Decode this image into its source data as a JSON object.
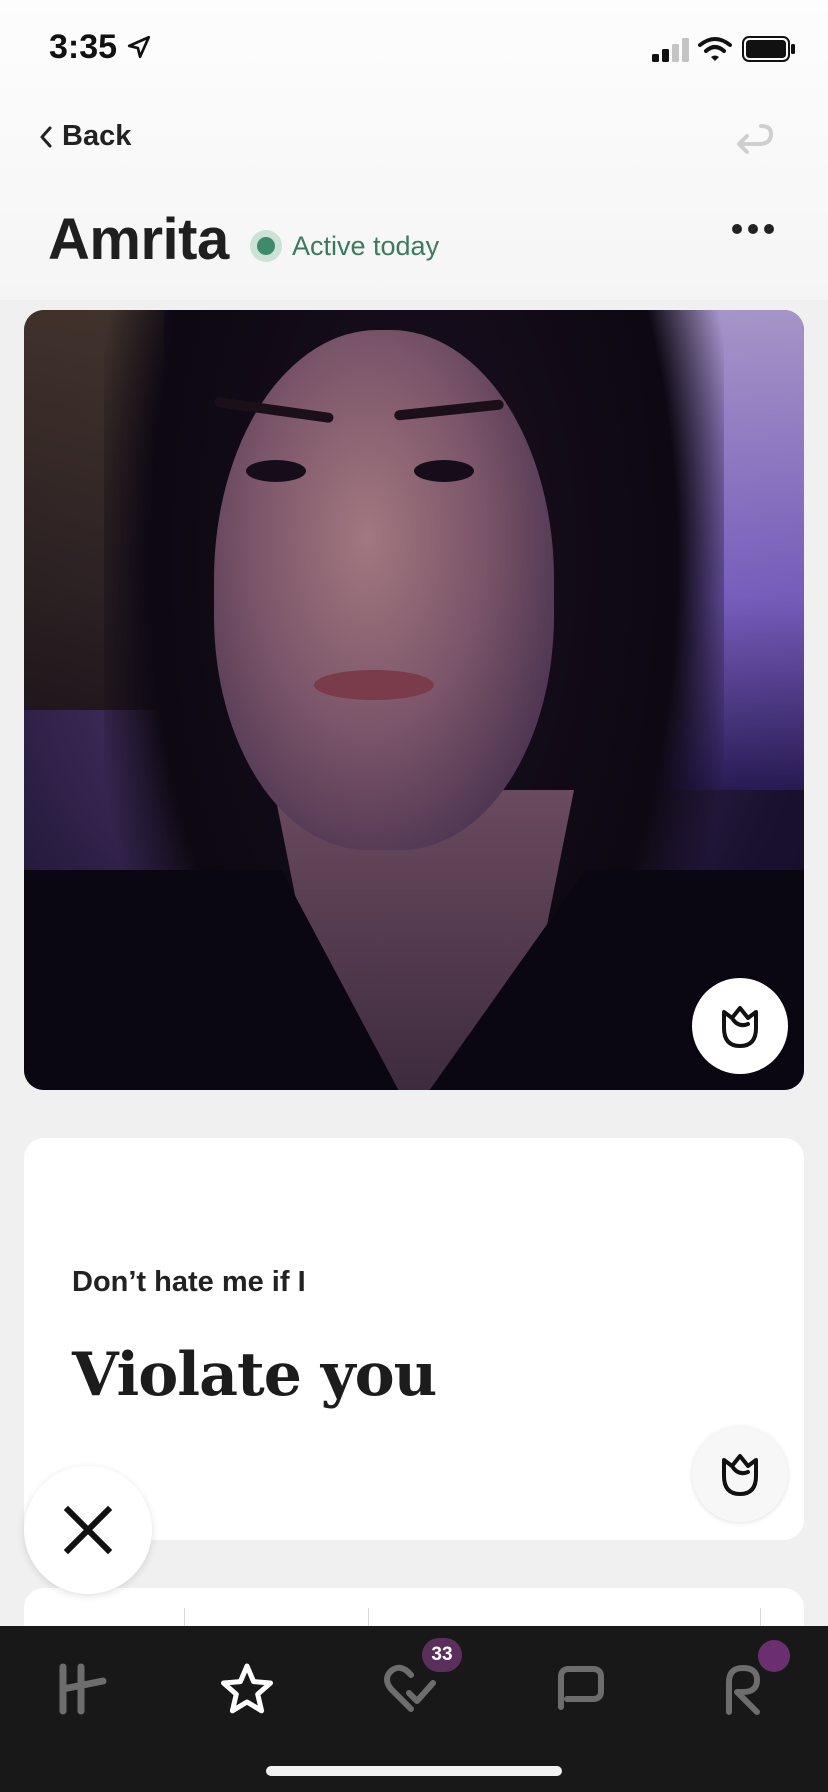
{
  "status_bar": {
    "time": "3:35"
  },
  "nav": {
    "back_label": "Back"
  },
  "profile": {
    "name": "Amrita",
    "activity_status": "Active today"
  },
  "prompt": {
    "question": "Don’t hate me if I",
    "answer": "Violate you"
  },
  "tab_bar": {
    "tabs": [
      "home-icon",
      "star-icon",
      "likes-icon",
      "chat-icon",
      "profile-icon"
    ],
    "likes_badge_count": "33"
  },
  "colors": {
    "accent_active": "#3f8a68",
    "badge": "#5a2f5c",
    "tab_bar_bg": "#181818"
  }
}
